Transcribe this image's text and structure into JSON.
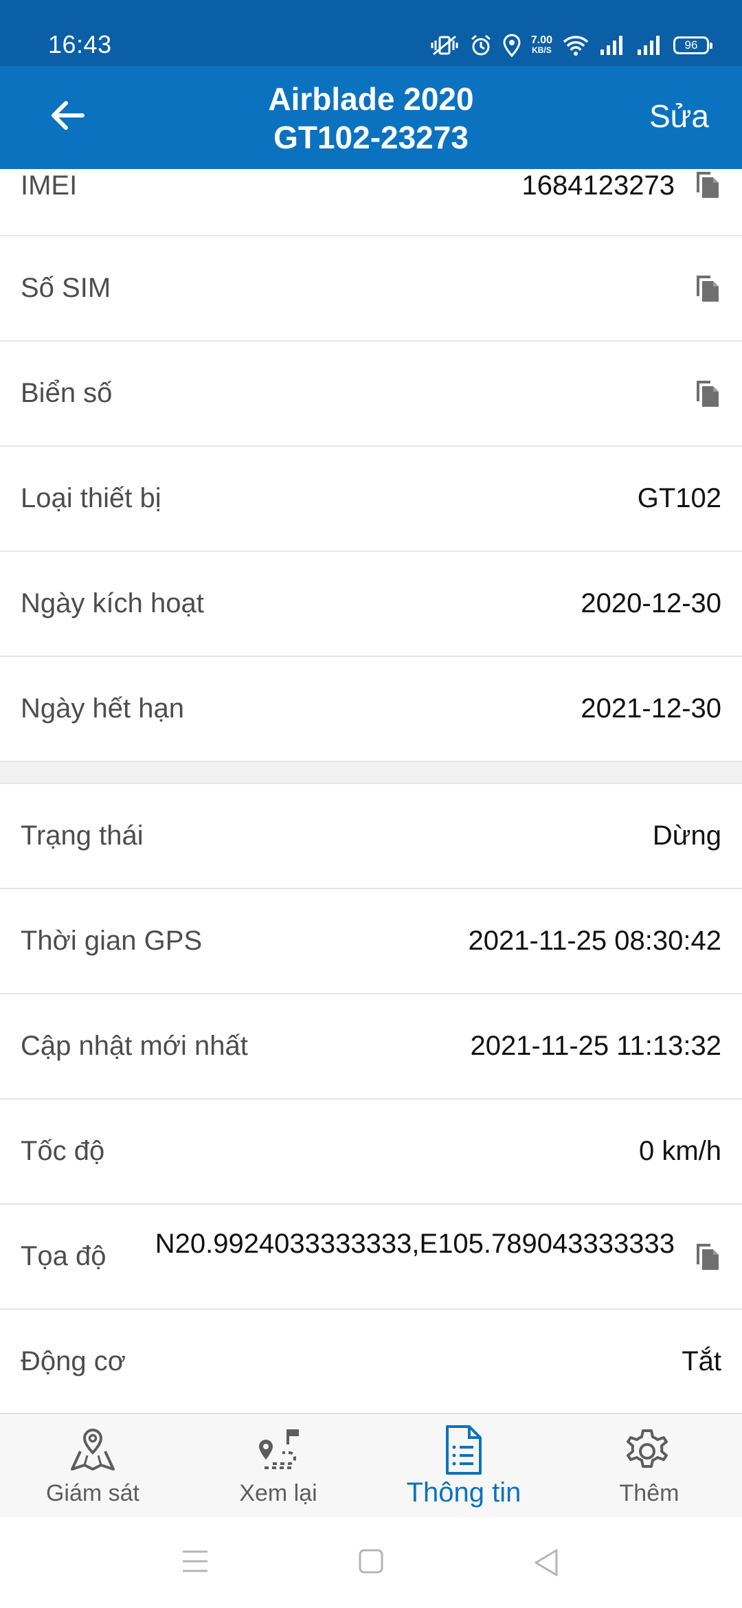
{
  "status_bar": {
    "time": "16:43",
    "speed_value": "7.00",
    "speed_unit": "KB/S",
    "battery": "96",
    "icons": [
      "vibrate-icon",
      "alarm-icon",
      "location-icon",
      "wifi-icon",
      "signal-icon",
      "signal-icon",
      "battery-icon"
    ]
  },
  "app_bar": {
    "back_icon": "arrow-left-icon",
    "title_line1": "Airblade 2020",
    "title_line2": "GT102-23273",
    "edit_label": "Sửa"
  },
  "device_info": [
    {
      "label": "IMEI",
      "value": "1684123273",
      "copy": true
    },
    {
      "label": "Số SIM",
      "value": "",
      "copy": true
    },
    {
      "label": "Biển số",
      "value": "",
      "copy": true
    },
    {
      "label": "Loại thiết bị",
      "value": "GT102",
      "copy": false
    },
    {
      "label": "Ngày kích hoạt",
      "value": "2020-12-30",
      "copy": false
    },
    {
      "label": "Ngày hết hạn",
      "value": "2021-12-30",
      "copy": false
    }
  ],
  "status_info": [
    {
      "label": "Trạng thái",
      "value": "Dừng",
      "copy": false
    },
    {
      "label": "Thời gian GPS",
      "value": "2021-11-25 08:30:42",
      "copy": false
    },
    {
      "label": "Cập nhật mới nhất",
      "value": "2021-11-25 11:13:32",
      "copy": false
    },
    {
      "label": "Tốc độ",
      "value": "0 km/h",
      "copy": false
    },
    {
      "label": "Tọa độ",
      "value": "N20.9924033333333,E105.789043333333",
      "copy": true
    },
    {
      "label": "Động cơ",
      "value": "Tắt",
      "copy": false
    }
  ],
  "bottom_nav": [
    {
      "label": "Giám sát",
      "icon": "map-pin-icon",
      "active": false
    },
    {
      "label": "Xem lại",
      "icon": "route-icon",
      "active": false
    },
    {
      "label": "Thông tin",
      "icon": "document-icon",
      "active": true
    },
    {
      "label": "Thêm",
      "icon": "gear-icon",
      "active": false
    }
  ],
  "colors": {
    "status_bar": "#0b5fa6",
    "app_bar": "#0b72c0",
    "accent": "#0b72c0"
  }
}
